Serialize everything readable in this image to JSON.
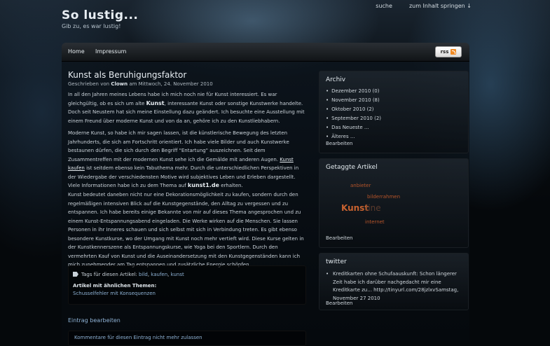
{
  "site": {
    "title": "So lustig...",
    "tagline": "Gib zu, es war lustig!"
  },
  "top_links": {
    "search": "suche",
    "skip": "zum Inhalt springen ↓"
  },
  "nav": {
    "home": "Home",
    "impressum": "Impressum",
    "rss": "rss"
  },
  "post": {
    "title": "Kunst als Beruhigungsfaktor",
    "meta_prefix": "Geschrieben von",
    "author": "Clown",
    "meta_suffix": "am Mittwoch, 24. November 2010",
    "p1_a": "In all den Jahren meines Lebens habe ich mich noch nie für Kunst interessiert. Es war gleichgültig, ob es sich um alte",
    "p1_hl": "Kunst",
    "p1_b": ", interessante Kunst oder sonstige Kunstwerke handelte. Doch seit Neustem hat sich meine Einstellung dazu geändert. Ich besuchte eine Ausstellung mit einem Freund über moderne Kunst und von da an, gehöre ich zu den Kunstliebhabern.",
    "p2_a": "Moderne Kunst, so habe ich mir sagen lassen, ist die künstlerische Bewegung des letzten Jahrhunderts, die sich am Fortschritt orientiert. Ich habe viele Bilder und auch Kunstwerke bestaunen dürfen, die sich durch den Begriff \"Entartung\" auszeichnen. Seit dem Zusammentreffen mit der modernen Kunst sehe ich die Gemälde mit anderen Augen.",
    "p2_link": "Kunst kaufen",
    "p2_b": "ist seitdem ebenso kein Tabuthema mehr. Durch die unterschiedlichen Perspektiven in der Wiedergabe der verschiedensten Motive wird subjektives Leben und Erleben dargestellt. Viele Informationen habe ich zu dem Thema auf",
    "p2_hl": "kunst1.de",
    "p2_c": "erhalten.",
    "p3": "Kunst bedeutet daneben nicht nur eine Dekorationsmöglichkeit zu kaufen, sondern durch den regelmäßigen intensiven Blick auf die Kunstgegenstände, den Alltag zu vergessen und zu entspannen. Ich habe bereits einige Bekannte von mir auf dieses Thema angesprochen und zu einem Kunst-Entspannungsabend eingeladen. Die Werke wirken auf die Menschen. Sie lassen Personen in ihr Inneres schauen und sich selbst mit sich in Verbindung treten. Es gibt ebenso besondere Kunstkurse, wo der Umgang mit Kunst noch mehr vertieft wird. Diese Kurse gelten in der Kunstkennerszene als Entspannungskurse, wie Yoga bei den Sportlern. Durch den vermehrten Kauf von Kunst und die Auseinandersetzung mit den Kunstgegenständen kann ich mich zunehmender am Tag entspannen und zusätzliche Energie schöpfen."
  },
  "tags": {
    "label": "Tags für diesen Artikel:",
    "items": [
      "bild",
      "kaufen",
      "kunst"
    ],
    "similar_label": "Artikel mit ähnlichen Themen:",
    "similar_link": "Schusselfehler mit Konsequenzen"
  },
  "edit_entry": "Eintrag bearbeiten",
  "comments_closed": "Kommentare für diesen Eintrag nicht mehr zulassen",
  "sidebar": {
    "archive": {
      "title": "Archiv",
      "items": [
        "Dezember 2010 (0)",
        "November 2010 (8)",
        "Oktober 2010 (2)",
        "September 2010 (2)",
        "Das Neueste ...",
        "Älteres ..."
      ],
      "edit": "Bearbeiten"
    },
    "tags": {
      "title": "Getaggte Artikel",
      "cloud": [
        "anbieter",
        "bilderrahmen",
        "Kunst",
        "line",
        "internet"
      ],
      "edit": "Bearbeiten"
    },
    "twitter": {
      "title": "twitter",
      "tweet": "Kreditkarten ohne Schufaauskunft: Schon längerer Zeit habe ich darüber nachgedacht mir eine Kreditkarte zu... http://tinyurl.com/28jzlxvSamstag, November 27 2010",
      "edit": "Bearbeiten"
    }
  },
  "colors": {
    "link": "#8fb3d6",
    "tag_cloud": "#b7552a",
    "rss_orange": "#f08a24"
  }
}
